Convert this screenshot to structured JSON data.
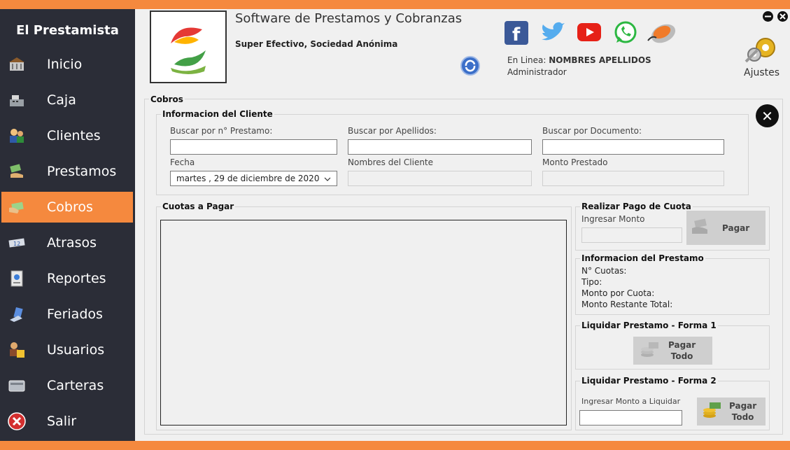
{
  "sidebar": {
    "brand": "El Prestamista",
    "items": [
      {
        "label": "Inicio",
        "icon": "bank-icon"
      },
      {
        "label": "Caja",
        "icon": "cash-register-icon"
      },
      {
        "label": "Clientes",
        "icon": "clients-icon"
      },
      {
        "label": "Prestamos",
        "icon": "money-hand-icon"
      },
      {
        "label": "Cobros",
        "icon": "collect-icon"
      },
      {
        "label": "Atrasos",
        "icon": "delay-icon"
      },
      {
        "label": "Reportes",
        "icon": "report-icon"
      },
      {
        "label": "Feriados",
        "icon": "holiday-icon"
      },
      {
        "label": "Usuarios",
        "icon": "users-icon"
      },
      {
        "label": "Carteras",
        "icon": "wallet-icon"
      },
      {
        "label": "Salir",
        "icon": "exit-icon"
      }
    ],
    "active": "Cobros"
  },
  "header": {
    "title": "Software de Prestamos y Cobranzas",
    "company": "Super Efectivo, Sociedad Anónima",
    "online_label": "En Linea:",
    "online_user": "NOMBRES APELLIDOS",
    "role": "Administrador",
    "settings_label": "Ajustes"
  },
  "cobros": {
    "title": "Cobros",
    "client_info": {
      "title": "Informacion del Cliente",
      "search_loan_label": "Buscar por n° Prestamo:",
      "search_lastname_label": "Buscar por Apellidos:",
      "search_document_label": "Buscar por Documento:",
      "date_label": "Fecha",
      "date_value": "martes   , 29 de diciembre de 2020",
      "client_name_label": "Nombres del Cliente",
      "loan_amount_label": "Monto Prestado"
    },
    "installments": {
      "title": "Cuotas a Pagar"
    },
    "payment": {
      "title": "Realizar Pago de Cuota",
      "amount_label": "Ingresar Monto",
      "pay_label": "Pagar"
    },
    "loan_info": {
      "title": "Informacion del Prestamo",
      "installments": "N° Cuotas:",
      "type": "Tipo:",
      "amount_per": "Monto por Cuota:",
      "remaining": "Monto Restante Total:"
    },
    "liquidate1": {
      "title": "Liquidar Prestamo - Forma 1",
      "btn_line1": "Pagar",
      "btn_line2": "Todo"
    },
    "liquidate2": {
      "title": "Liquidar Prestamo - Forma 2",
      "amount_label": "Ingresar Monto a Liquidar",
      "btn_line1": "Pagar",
      "btn_line2": "Todo"
    }
  },
  "colors": {
    "accent": "#f5893e",
    "sidebar": "#2b2d37"
  }
}
